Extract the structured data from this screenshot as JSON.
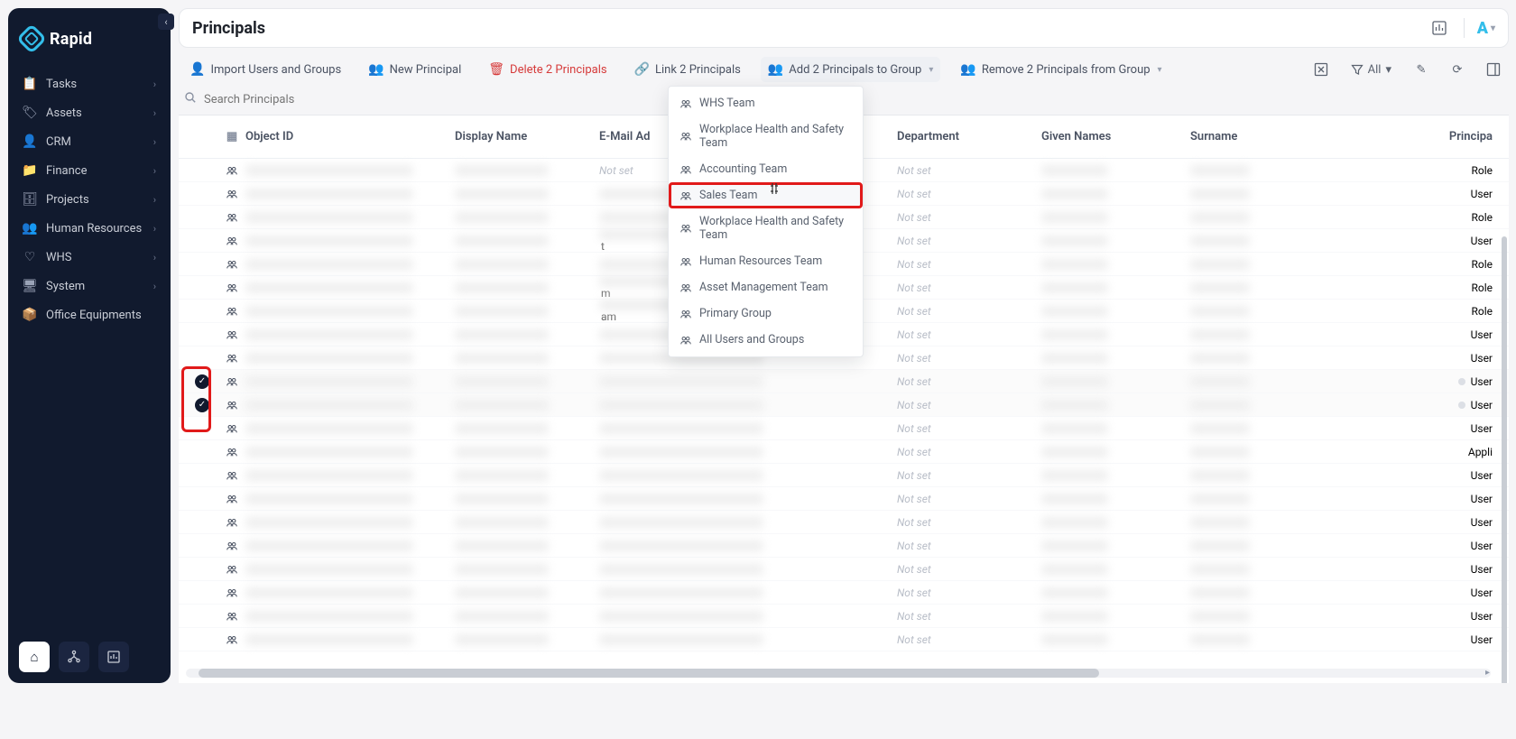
{
  "brand": {
    "name": "Rapid"
  },
  "sidebar": {
    "items": [
      {
        "label": "Tasks",
        "icon": "📋",
        "expandable": true
      },
      {
        "label": "Assets",
        "icon": "🏷",
        "expandable": true
      },
      {
        "label": "CRM",
        "icon": "👤",
        "expandable": true
      },
      {
        "label": "Finance",
        "icon": "📁",
        "expandable": true
      },
      {
        "label": "Projects",
        "icon": "🗄",
        "expandable": true
      },
      {
        "label": "Human Resources",
        "icon": "👥",
        "expandable": true
      },
      {
        "label": "WHS",
        "icon": "♡",
        "expandable": true
      },
      {
        "label": "System",
        "icon": "🖥",
        "expandable": true
      },
      {
        "label": "Office Equipments",
        "icon": "📦",
        "expandable": false
      }
    ]
  },
  "header": {
    "title": "Principals"
  },
  "toolbar": {
    "import": "Import Users and Groups",
    "new": "New Principal",
    "delete": "Delete 2 Principals",
    "link": "Link 2 Principals",
    "addGroup": "Add 2 Principals to Group",
    "remGroup": "Remove 2 Principals from Group",
    "filterAll": "All"
  },
  "search": {
    "placeholder": "Search Principals"
  },
  "columns": {
    "objectId": "Object ID",
    "display": "Display Name",
    "email": "E-Mail Ad",
    "department": "Department",
    "given": "Given Names",
    "surname": "Surname",
    "ptype": "Principa"
  },
  "notSet": "Not set",
  "rows": [
    {
      "selected": false,
      "email_notset": true,
      "dept_notset": true,
      "ptype": "Role",
      "blurText": ""
    },
    {
      "selected": false,
      "email_notset": false,
      "dept_notset": true,
      "ptype": "User",
      "blurText": ""
    },
    {
      "selected": false,
      "email_notset": false,
      "dept_notset": true,
      "ptype": "Role",
      "blurText": ""
    },
    {
      "selected": false,
      "email_notset": false,
      "dept_notset": true,
      "ptype": "User",
      "blurText": "t"
    },
    {
      "selected": false,
      "email_notset": false,
      "dept_notset": true,
      "ptype": "Role",
      "blurText": ""
    },
    {
      "selected": false,
      "email_notset": false,
      "dept_notset": true,
      "ptype": "Role",
      "blurText": "m"
    },
    {
      "selected": false,
      "email_notset": false,
      "dept_notset": true,
      "ptype": "Role",
      "blurText": "am"
    },
    {
      "selected": false,
      "email_notset": false,
      "dept_notset": true,
      "ptype": "User",
      "blurText": ""
    },
    {
      "selected": false,
      "email_notset": false,
      "dept_notset": true,
      "ptype": "User",
      "blurText": ""
    },
    {
      "selected": true,
      "email_notset": false,
      "dept_notset": true,
      "ptype": "User",
      "blurText": "",
      "dot": true
    },
    {
      "selected": true,
      "email_notset": false,
      "dept_notset": true,
      "ptype": "User",
      "blurText": "",
      "dot": true
    },
    {
      "selected": false,
      "email_notset": false,
      "dept_notset": true,
      "ptype": "User",
      "blurText": ""
    },
    {
      "selected": false,
      "email_notset": false,
      "dept_notset": true,
      "ptype": "Appli",
      "blurText": ""
    },
    {
      "selected": false,
      "email_notset": false,
      "dept_notset": true,
      "ptype": "User",
      "blurText": ""
    },
    {
      "selected": false,
      "email_notset": false,
      "dept_notset": true,
      "ptype": "User",
      "blurText": ""
    },
    {
      "selected": false,
      "email_notset": false,
      "dept_notset": true,
      "ptype": "User",
      "blurText": ""
    },
    {
      "selected": false,
      "email_notset": false,
      "dept_notset": true,
      "ptype": "User",
      "blurText": ""
    },
    {
      "selected": false,
      "email_notset": false,
      "dept_notset": true,
      "ptype": "User",
      "blurText": ""
    },
    {
      "selected": false,
      "email_notset": false,
      "dept_notset": true,
      "ptype": "User",
      "blurText": ""
    },
    {
      "selected": false,
      "email_notset": false,
      "dept_notset": true,
      "ptype": "User",
      "blurText": ""
    },
    {
      "selected": false,
      "email_notset": false,
      "dept_notset": true,
      "ptype": "User",
      "blurText": ""
    }
  ],
  "dropdown": {
    "items": [
      {
        "label": "WHS Team"
      },
      {
        "label": "Workplace Health and Safety Team"
      },
      {
        "label": "Accounting Team"
      },
      {
        "label": "Sales Team",
        "highlight": true
      },
      {
        "label": "Workplace Health and Safety Team"
      },
      {
        "label": "Human Resources Team"
      },
      {
        "label": "Asset Management Team"
      },
      {
        "label": "Primary Group"
      },
      {
        "label": "All Users and Groups"
      }
    ]
  }
}
